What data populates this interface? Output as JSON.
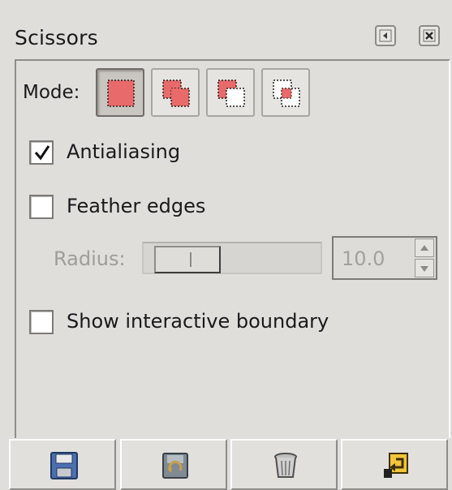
{
  "panel": {
    "title": "Scissors"
  },
  "mode": {
    "label": "Mode:",
    "options": [
      {
        "name": "replace-selection",
        "active": true
      },
      {
        "name": "add-to-selection",
        "active": false
      },
      {
        "name": "subtract-from-selection",
        "active": false
      },
      {
        "name": "intersect-with-selection",
        "active": false
      }
    ]
  },
  "options": {
    "antialiasing": {
      "label": "Antialiasing",
      "checked": true
    },
    "feather_edges": {
      "label": "Feather edges",
      "checked": false
    },
    "radius": {
      "label": "Radius:",
      "value": "10.0",
      "enabled": false
    },
    "show_interactive_boundary": {
      "label": "Show interactive boundary",
      "checked": false
    }
  },
  "actions": [
    {
      "icon": "save-icon"
    },
    {
      "icon": "restore-icon"
    },
    {
      "icon": "delete-icon"
    },
    {
      "icon": "reset-icon"
    }
  ],
  "colors": {
    "panel_bg": "#e0dedb",
    "selection_red": "#e86a6a"
  }
}
